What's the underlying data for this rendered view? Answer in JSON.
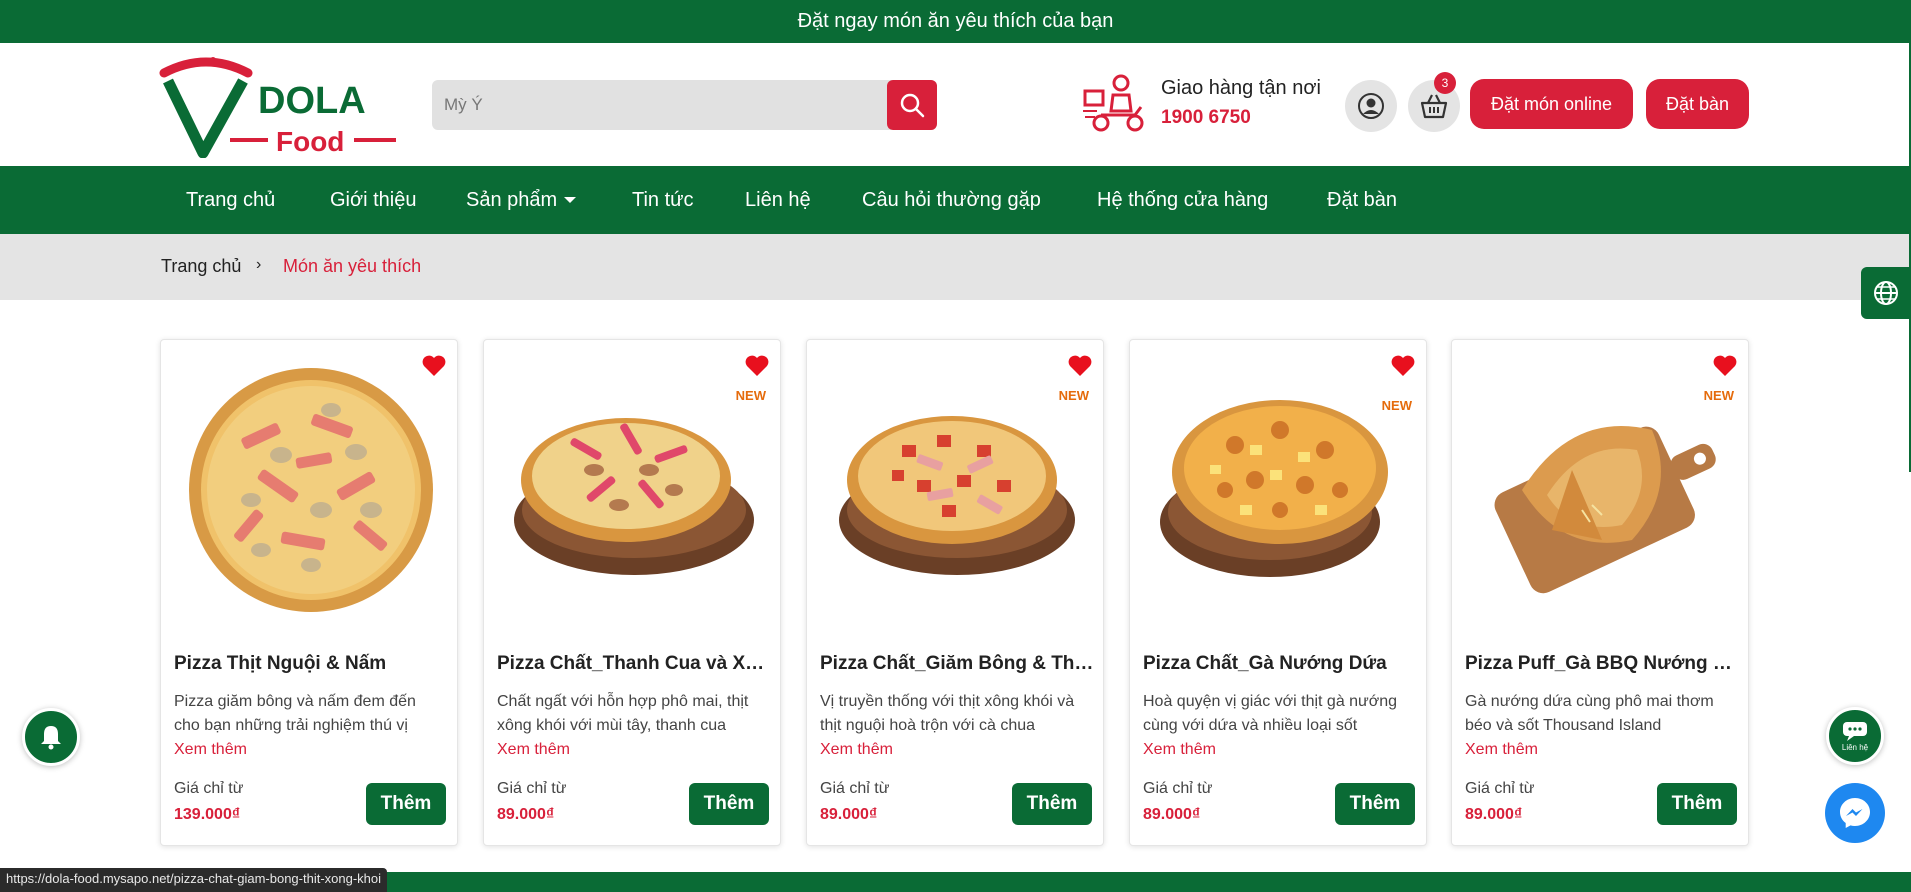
{
  "topbar": {
    "text": "Đặt ngay món ăn yêu thích của bạn"
  },
  "logo": {
    "line1": "DOLA",
    "line2": "Food"
  },
  "search": {
    "placeholder": "Mỳ Ý"
  },
  "delivery": {
    "title": "Giao hàng tận nơi",
    "phone": "1900 6750"
  },
  "cart": {
    "count": "3"
  },
  "header_buttons": {
    "order_online": "Đặt món online",
    "book_table": "Đặt bàn"
  },
  "nav": {
    "items": [
      {
        "label": "Trang chủ"
      },
      {
        "label": "Giới thiệu"
      },
      {
        "label": "Sản phẩm"
      },
      {
        "label": "Tin tức"
      },
      {
        "label": "Liên hệ"
      },
      {
        "label": "Câu hỏi thường gặp"
      },
      {
        "label": "Hệ thống cửa hàng"
      },
      {
        "label": "Đặt bàn"
      }
    ]
  },
  "breadcrumb": {
    "home": "Trang chủ",
    "separator": "›",
    "current": "Món ăn yêu thích"
  },
  "products": [
    {
      "name": "Pizza Thịt Nguội & Nấm",
      "desc": "Pizza giăm bông và nấm đem đến cho bạn những trải nghiệm thú vị",
      "more": "Xem thêm",
      "price_label": "Giá chỉ từ",
      "price": "139.000₫",
      "add": "Thêm",
      "badge": ""
    },
    {
      "name": "Pizza Chất_Thanh Cua và Xông Khói",
      "desc": "Chất ngất với hỗn hợp phô mai, thịt xông khói với mùi tây, thanh cua",
      "more": "Xem thêm",
      "price_label": "Giá chỉ từ",
      "price": "89.000₫",
      "add": "Thêm",
      "badge": "NEW"
    },
    {
      "name": "Pizza Chất_Giăm Bông & Thịt Xông Khói",
      "desc": "Vị truyền thống với thịt xông khói và thịt nguội hoà trộn với cà chua",
      "more": "Xem thêm",
      "price_label": "Giá chỉ từ",
      "price": "89.000₫",
      "add": "Thêm",
      "badge": "NEW"
    },
    {
      "name": "Pizza Chất_Gà Nướng Dứa",
      "desc": "Hoà quyện vị giác với thịt gà nướng cùng với dứa và nhiều loại sốt",
      "more": "Xem thêm",
      "price_label": "Giá chỉ từ",
      "price": "89.000₫",
      "add": "Thêm",
      "badge": "NEW"
    },
    {
      "name": "Pizza Puff_Gà BBQ Nướng Dứa",
      "desc": "Gà nướng dứa cùng phô mai thơm béo và sốt Thousand Island",
      "more": "Xem thêm",
      "price_label": "Giá chỉ từ",
      "price": "89.000₫",
      "add": "Thêm",
      "badge": "NEW"
    }
  ],
  "floating": {
    "contact_label": "Liên hệ"
  },
  "status_bar": {
    "url": "https://dola-food.mysapo.net/pizza-chat-giam-bong-thit-xong-khoi"
  },
  "colors": {
    "brand_green": "#0a6b35",
    "accent_red": "#d8203a",
    "new_orange": "#e56b0c"
  }
}
